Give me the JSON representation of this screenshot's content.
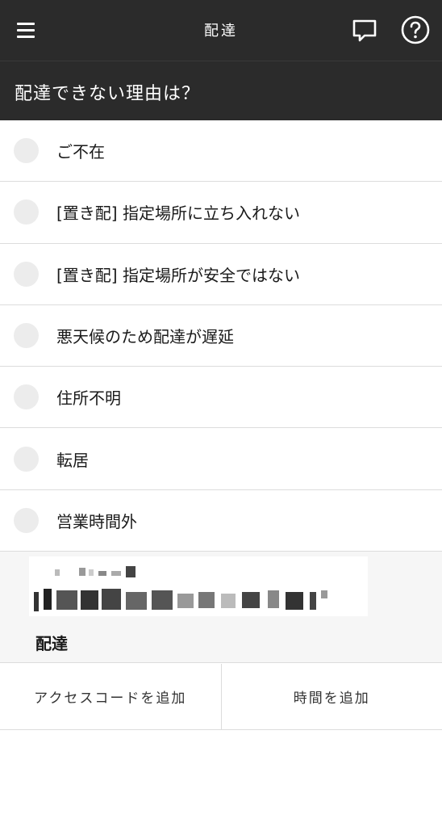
{
  "header": {
    "title": "配達",
    "icons": {
      "menu": "menu-icon",
      "chat": "chat-bubble-icon",
      "help": "help-circle-icon"
    }
  },
  "question": "配達できない理由は？",
  "reasons": [
    {
      "label": "ご不在"
    },
    {
      "label": "[置き配] 指定場所に立ち入れない"
    },
    {
      "label": "[置き配] 指定場所が安全ではない"
    },
    {
      "label": "悪天候のため配達が遅延"
    },
    {
      "label": "住所不明"
    },
    {
      "label": "転居"
    },
    {
      "label": "営業時間外"
    }
  ],
  "info": {
    "status": "配達"
  },
  "actions": {
    "access_code": "アクセスコードを追加",
    "time": "時間を追加"
  },
  "colors": {
    "header_bg": "#2b2b2b",
    "radio_fill": "#ececec",
    "divider": "#dcdcdc"
  }
}
